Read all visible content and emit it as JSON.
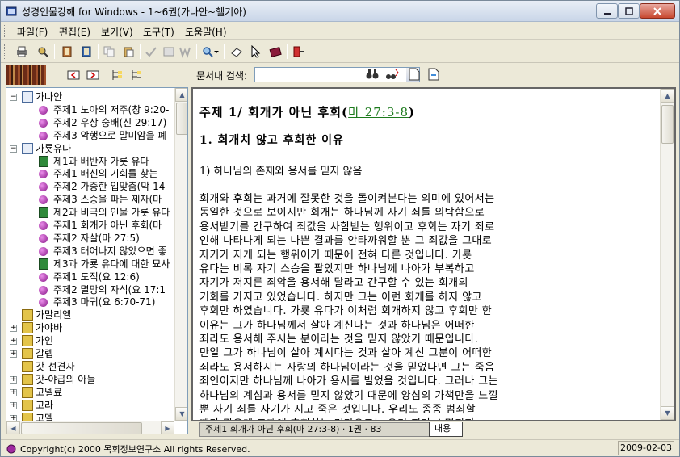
{
  "window": {
    "title": "성경인물강해 for Windows - 1~6권(가나안~헬기아)"
  },
  "menu": [
    "파일(F)",
    "편집(E)",
    "보기(V)",
    "도구(T)",
    "도움말(H)"
  ],
  "search": {
    "label": "문서내 검색:",
    "value": ""
  },
  "tree": [
    {
      "label": "가나안",
      "level": 0,
      "kind": "folder",
      "expander": "−"
    },
    {
      "label": "주제1 노아의 저주(창 9:20-",
      "level": 1,
      "kind": "dot"
    },
    {
      "label": "주제2 우상 숭배(신 29:17)",
      "level": 1,
      "kind": "dot"
    },
    {
      "label": "주제3 악행으로 말미암을 폐",
      "level": 1,
      "kind": "dot"
    },
    {
      "label": "가룟유다",
      "level": 0,
      "kind": "folder",
      "expander": "−"
    },
    {
      "label": "제1과 배반자 가룟 유다",
      "level": 1,
      "kind": "green"
    },
    {
      "label": "주제1 배신의 기회를 찾는",
      "level": 1,
      "kind": "dot"
    },
    {
      "label": "주제2 가증한 입맞춤(막 14",
      "level": 1,
      "kind": "dot"
    },
    {
      "label": "주제3 스승을 파는 제자(마",
      "level": 1,
      "kind": "dot"
    },
    {
      "label": "제2과 비극의 인물 가룟 유다",
      "level": 1,
      "kind": "green"
    },
    {
      "label": "주제1 회개가 아닌 후회(마",
      "level": 1,
      "kind": "dot"
    },
    {
      "label": "주제2 자살(마 27:5)",
      "level": 1,
      "kind": "dot"
    },
    {
      "label": "주제3 태어나지 않았으면 좋",
      "level": 1,
      "kind": "dot"
    },
    {
      "label": "제3과 가룟 유다에 대한 묘사",
      "level": 1,
      "kind": "green"
    },
    {
      "label": "주제1 도적(요 12:6)",
      "level": 1,
      "kind": "dot"
    },
    {
      "label": "주제2 멸망의 자식(요 17:1",
      "level": 1,
      "kind": "dot"
    },
    {
      "label": "주제3 마귀(요 6:70-71)",
      "level": 1,
      "kind": "dot"
    },
    {
      "label": "가말리엘",
      "level": 0,
      "kind": "yellow",
      "expander": ""
    },
    {
      "label": "가야바",
      "level": 0,
      "kind": "yellow",
      "expander": "+"
    },
    {
      "label": "가인",
      "level": 0,
      "kind": "yellow",
      "expander": "+"
    },
    {
      "label": "갈렙",
      "level": 0,
      "kind": "yellow",
      "expander": "+"
    },
    {
      "label": "갓-선견자",
      "level": 0,
      "kind": "yellow",
      "expander": ""
    },
    {
      "label": "갓-야곱의 아들",
      "level": 0,
      "kind": "yellow",
      "expander": "+"
    },
    {
      "label": "고넬료",
      "level": 0,
      "kind": "yellow",
      "expander": "+"
    },
    {
      "label": "고라",
      "level": 0,
      "kind": "yellow",
      "expander": "+"
    },
    {
      "label": "고멜",
      "level": 0,
      "kind": "yellow",
      "expander": "+"
    }
  ],
  "content": {
    "title": "주제 1/ 회개가 아닌 후회",
    "open_paren": "(",
    "ref": "마 27:3-8",
    "close_paren": ")",
    "heading": "1. 회개치 않고 후회한 이유",
    "subheading": "1) 하나님의 존재와 용서를 믿지 않음",
    "body_lines": [
      "회개와 후회는 과거에 잘못한 것을 돌이켜본다는 의미에 있어서는",
      "동일한 것으로 보이지만 회개는 하나님께 자기 죄를 의탁함으로",
      "용서받기를 간구하여 죄값을 사함받는 행위이고 후회는 자기 죄로",
      "인해 나타나게 되는 나쁜 결과를 안타까워할 뿐 그 죄값을 그대로",
      "자기가 지게 되는 행위이기 때문에 전혀 다른 것입니다. 가룟",
      "유다는 비록 자기 스승을 팔았지만 하나님께 나아가 부복하고",
      "자기가 저지른 죄악을 용서해 달라고 간구할 수 있는 회개의",
      "기회를 가지고 있었습니다. 하지만 그는 이런 회개를 하지 않고",
      "후회만 하였습니다. 가룟 유다가 이처럼 회개하지 않고 후회만 한",
      "이유는 그가 하나님께서 살아 계신다는 것과 하나님은 어떠한",
      "죄라도 용서해 주시는 분이라는 것을 믿지 않았기 때문입니다.",
      "만일 그가 하나님이 살아 계시다는 것과 살아 계신 그분이 어떠한",
      "죄라도 용서하시는 사랑의 하나님이라는 것을 믿었다면 그는 죽음",
      "죄인이지만 하나님께 나아가 용서를 빌었을 것입니다. 그러나 그는",
      "하나님의 계심과 용서를 믿지 않았기 때문에 양심의 가책만을 느낄",
      "뿐 자기 죄를 자기가 지고 죽은 것입니다. 우리도 종종 범죄할",
      "때가 많은데 그때에 후회하는 것만으로는 우리 죄가 소멸되지"
    ]
  },
  "tabs": {
    "info": "주제1 회개가 아닌 후회(마 27:3-8) · 1권 · 83",
    "content": "내용"
  },
  "status": {
    "copyright": "Copyright(c) 2000  목회정보연구소  All rights Reserved.",
    "date": "2009-02-03"
  }
}
